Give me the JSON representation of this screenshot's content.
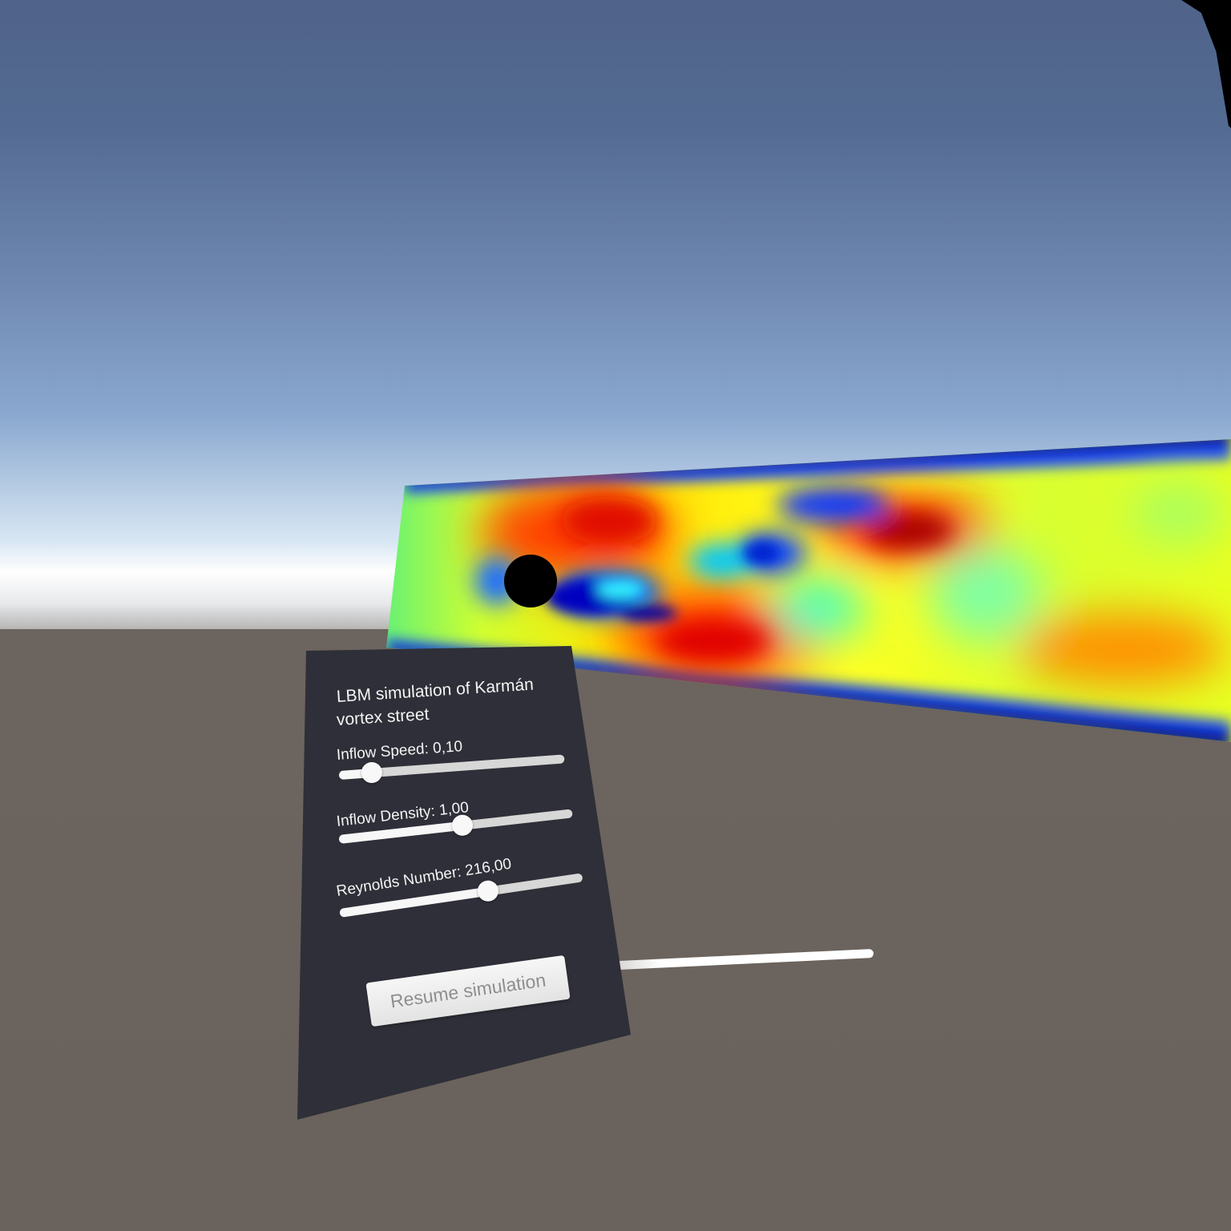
{
  "panel": {
    "title_line1": "LBM simulation of Karmán",
    "title_line2": "vortex street",
    "sliders": [
      {
        "label": "Inflow Speed: 0,10",
        "fill_fraction": 0.145
      },
      {
        "label": "Inflow Density: 1,00",
        "fill_fraction": 0.53
      },
      {
        "label": "Reynolds Number: 216,00",
        "fill_fraction": 0.61
      }
    ],
    "resume_label": "Resume simulation"
  },
  "colors": {
    "panel_bg": "#2e2f38",
    "sky_top": "#50638a",
    "horizon": "#ffffff",
    "ground": "#6a625c",
    "cylinder": "#000000"
  }
}
